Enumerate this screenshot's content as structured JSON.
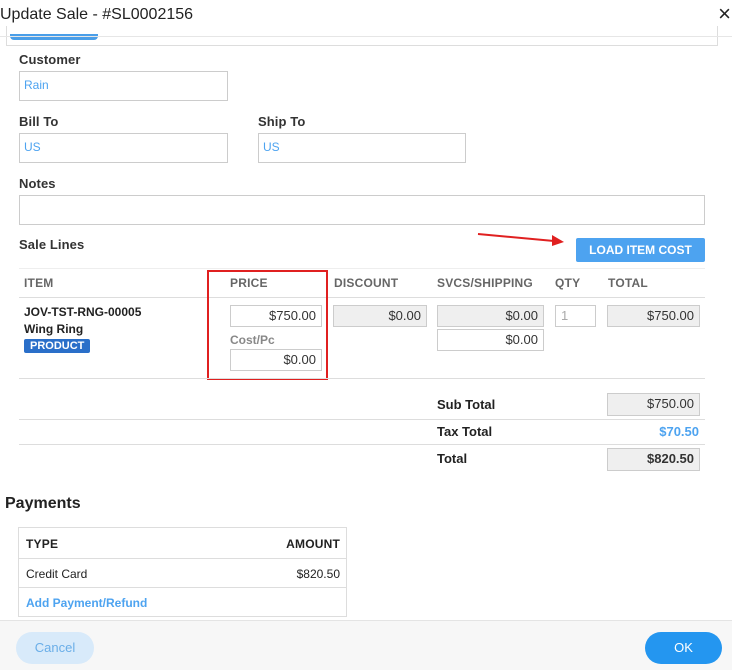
{
  "dialog": {
    "title": "Update Sale - #SL0002156",
    "close_symbol": "×"
  },
  "form": {
    "customer": {
      "label": "Customer",
      "value": "Rain"
    },
    "bill_to": {
      "label": "Bill To",
      "value": "US"
    },
    "ship_to": {
      "label": "Ship To",
      "value": "US"
    },
    "notes": {
      "label": "Notes",
      "value": ""
    }
  },
  "sale_lines": {
    "title": "Sale Lines",
    "load_cost_label": "LOAD ITEM COST",
    "headers": [
      "ITEM",
      "PRICE",
      "DISCOUNT",
      "SVCS/SHIPPING",
      "QTY",
      "TOTAL"
    ],
    "line": {
      "sku": "JOV-TST-RNG-00005",
      "name": "Wing Ring",
      "badge": "PRODUCT",
      "price": "$750.00",
      "cost_label": "Cost/Pc",
      "cost": "$0.00",
      "discount": "$0.00",
      "svcs": "$0.00",
      "shipping": "$0.00",
      "qty": "1",
      "total": "$750.00"
    },
    "totals": {
      "sub_total_label": "Sub Total",
      "sub_total": "$750.00",
      "tax_total_label": "Tax Total",
      "tax_total": "$70.50",
      "total_label": "Total",
      "total": "$820.50"
    }
  },
  "payments": {
    "title": "Payments",
    "headers": [
      "TYPE",
      "AMOUNT"
    ],
    "rows": [
      {
        "type": "Credit Card",
        "amount": "$820.50"
      }
    ],
    "add_link": "Add Payment/Refund"
  },
  "footer": {
    "cancel_label": "Cancel",
    "ok_label": "OK"
  },
  "colors": {
    "accent": "#4da3f0",
    "primary_button": "#2496f0",
    "annotation": "#e02020",
    "badge": "#2a6fc9"
  },
  "icons": {
    "close": "close-icon",
    "arrow": "red-arrow-annotation"
  }
}
